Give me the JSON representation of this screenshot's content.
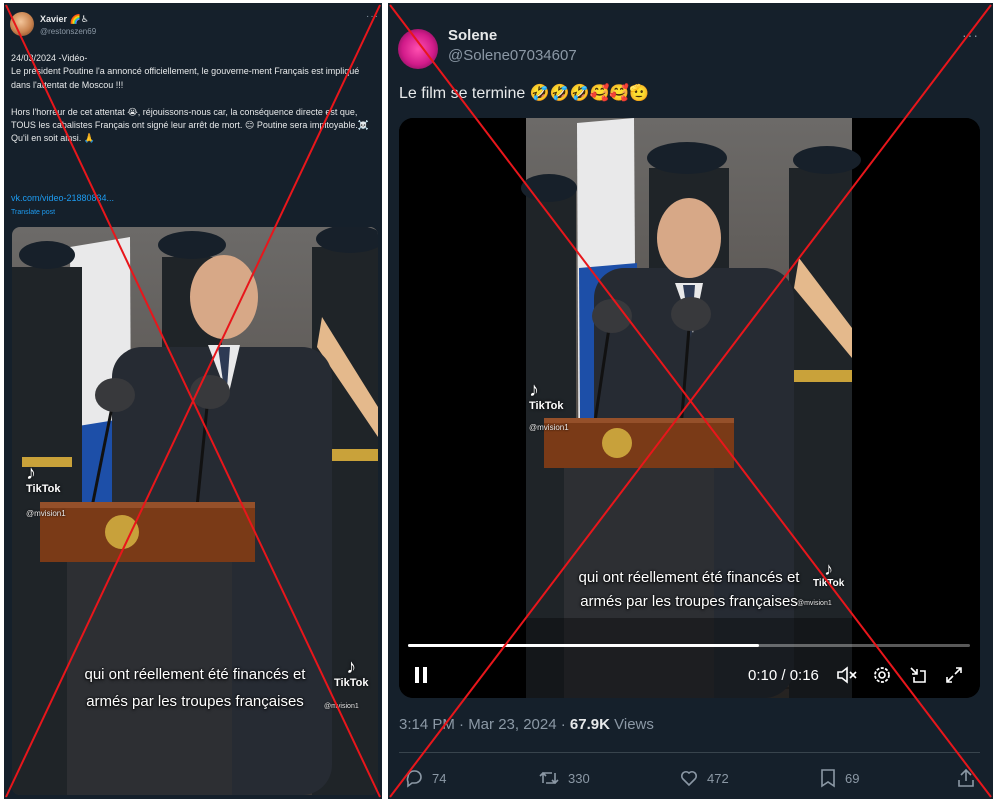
{
  "left_post": {
    "author_name": "Xavier",
    "author_emojis": "🌈♿",
    "handle": "@restonszen69",
    "text": "24/03/2024 -Vidéo-\nLe président Poutine l'a annoncé officiellement, le gouverne-ment Français est impliqué dans l'attentat de Moscou !!!\n\nHors l'horreur de cet attentat 😭, réjouissons-nous car, la conséquence directe est que, TOUS les cabalistes Français ont signé leur arrêt de mort. 😑 Poutine sera impitoyable.☠️\nQu'il en soit ainsi. 🙏",
    "link": "vk.com/video-21880834...",
    "translate": "Translate post",
    "video": {
      "tiktok_label": "TikTok",
      "tiktok_handle": "@mvision1",
      "tiktok_label_2": "TikTok",
      "tiktok_handle_2": "@mvision1",
      "caption_line1": "qui ont réellement été financés et",
      "caption_line2": "armés par les troupes françaises"
    }
  },
  "right_post": {
    "author_name": "Solene",
    "handle": "@Solene07034607",
    "text": "Le film se termine 🤣🤣🤣🥰🥰🫡",
    "video": {
      "tiktok_label": "TikTok",
      "tiktok_handle": "@mvision1",
      "tiktok_label_2": "TikTok",
      "tiktok_handle_2": "@mvision1",
      "caption_line1": "qui ont réellement été financés et",
      "caption_line2": "armés par les troupes françaises",
      "time_display": "0:10 / 0:16",
      "progress": 0.625
    },
    "timestamp": "3:14 PM · Mar 23, 2024 ·",
    "views_count": "67.9K",
    "views_label": "Views",
    "actions": {
      "replies": "74",
      "reposts": "330",
      "likes": "472",
      "bookmarks": "69"
    }
  },
  "colors": {
    "background": "#15202b",
    "text": "#e7e9ea",
    "muted": "#8b98a5",
    "link": "#1d9bf0",
    "cross": "#e8161b"
  },
  "icons": [
    "more-icon",
    "pause-icon",
    "volume-mute-icon",
    "settings-icon",
    "pip-icon",
    "fullscreen-icon",
    "reply-icon",
    "repost-icon",
    "like-icon",
    "bookmark-icon",
    "share-icon",
    "tiktok-icon"
  ]
}
